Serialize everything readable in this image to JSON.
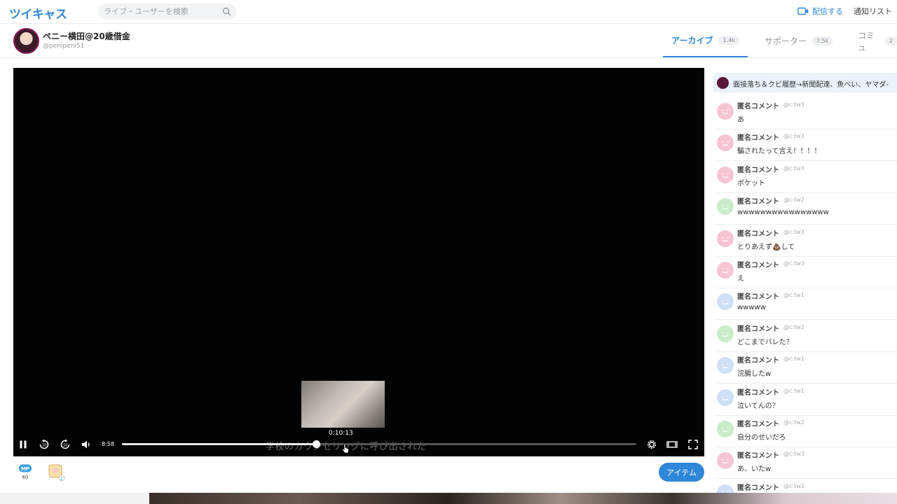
{
  "header": {
    "logo": "ツイキャス",
    "search_placeholder": "ライブ・ユーザーを検索",
    "broadcast_label": "配信する",
    "notify_label": "通知リスト"
  },
  "channel": {
    "name": "ペニー横田@20歳借金",
    "handle": "@penipeni51",
    "tabs": [
      {
        "label": "アーカイブ",
        "count": "1.4k",
        "active": true
      },
      {
        "label": "サポーター",
        "count": "7.5k",
        "active": false
      },
      {
        "label": "コミュ",
        "count": "2",
        "active": false
      }
    ]
  },
  "player": {
    "current_time": "8:58",
    "hover_time": "0:10:13",
    "subtitle": "学校のカウンセリングに呼び出された",
    "progress_fraction": 0.378
  },
  "actions": {
    "item_button": "アイテム",
    "mp_label": "MP",
    "mp_value": "60",
    "gift_count": "2"
  },
  "chat": {
    "pinned_text": "面接落ち＆クビ履歴→新聞配達、魚べい、ヤマダ-",
    "comments": [
      {
        "name": "匿名コメント",
        "handle": "@c:tw3",
        "text": "あ",
        "color": "#f6c5d4"
      },
      {
        "name": "匿名コメント",
        "handle": "@c:tw3",
        "text": "騙されたって言え！！！！",
        "color": "#f6c5d4"
      },
      {
        "name": "匿名コメント",
        "handle": "@c:tw3",
        "text": "ポケット",
        "color": "#f6c5d4"
      },
      {
        "name": "匿名コメント",
        "handle": "@c:tw2",
        "text": "wwwwwwwwwwwwwwww",
        "color": "#c8ecc8"
      },
      {
        "name": "匿名コメント",
        "handle": "@c:tw3",
        "text": "とりあえず💩して",
        "color": "#f6c5d4"
      },
      {
        "name": "匿名コメント",
        "handle": "@c:tw3",
        "text": "え",
        "color": "#f6c5d4"
      },
      {
        "name": "匿名コメント",
        "handle": "@c:tw1",
        "text": "wwwww",
        "color": "#cfdff6"
      },
      {
        "name": "匿名コメント",
        "handle": "@c:tw2",
        "text": "どこまでバレた？",
        "color": "#c8ecc8"
      },
      {
        "name": "匿名コメント",
        "handle": "@c:tw1",
        "text": "浣腸したw",
        "color": "#cfdff6"
      },
      {
        "name": "匿名コメント",
        "handle": "@c:tw1",
        "text": "泣いてんの？",
        "color": "#cfdff6"
      },
      {
        "name": "匿名コメント",
        "handle": "@c:tw2",
        "text": "自分のせいだろ",
        "color": "#c8ecc8"
      },
      {
        "name": "匿名コメント",
        "handle": "@c:tw3",
        "text": "あ、いたw",
        "color": "#f6c5d4"
      },
      {
        "name": "匿名コメント",
        "handle": "@c:tw1",
        "text": "",
        "color": "#cfdff6"
      }
    ]
  }
}
